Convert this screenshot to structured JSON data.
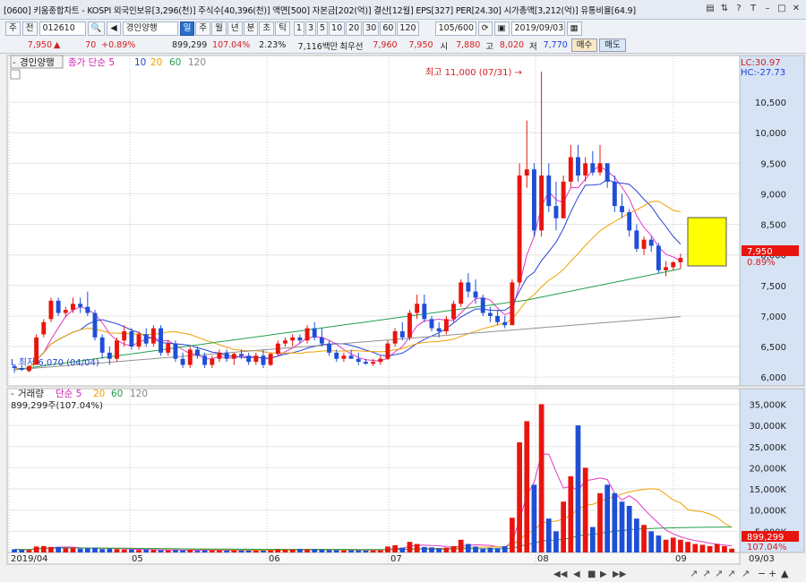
{
  "window": {
    "title": "[0600] 키움종합차트 - KOSPI 외국인보유[3,296(천)] 주식수[40,396(천)] 액면[500] 자본금[202(억)] 결산[12월] EPS[327] PER[24.30] 시가총액[3,212(억)] 유통비율[64.9]"
  },
  "toolbar": {
    "type_label": "주",
    "prev_label": "전",
    "code": "012610",
    "stock_name": "경인양행",
    "period_tabs": [
      "일",
      "주",
      "월",
      "년",
      "분",
      "초",
      "틱"
    ],
    "active_period": "일",
    "intervals": [
      "1",
      "3",
      "5",
      "10",
      "20",
      "30",
      "60",
      "120"
    ],
    "count": "105/600",
    "date": "2019/09/03"
  },
  "quote": {
    "price": "7,950",
    "change": "70",
    "change_pct": "+0.89%",
    "volume": "899,299",
    "volume_ratio": "107.04%",
    "turnover": "2.23%",
    "amount": "7,116백만",
    "best_label": "최우선",
    "ask": "7,960",
    "bid": "7,950",
    "open_label": "시",
    "open": "7,880",
    "high_label": "고",
    "high": "8,020",
    "low_label": "저",
    "low": "7,770",
    "buy_label": "매수",
    "sell_label": "매도"
  },
  "price_pane": {
    "legend_name": "경인양행",
    "legend_ma": "종가 단순 5",
    "ma_periods": [
      "10",
      "20",
      "60",
      "120"
    ],
    "lc_label": "LC:30.97",
    "hc_label": "HC:-27.73",
    "high_annotation": "최고 11,000 (07/31) →",
    "low_annotation": "L 최저 6,070 (04/04)",
    "current_price_tag": "7,950",
    "current_pct_tag": "0.89%"
  },
  "volume_pane": {
    "legend_name": "거래량",
    "legend_ma": "단순 5",
    "ma_periods": [
      "20",
      "60",
      "120"
    ],
    "info": "899,299주(107.04%)",
    "current_tag": "899,299",
    "pct_tag": "107.04%"
  },
  "colors": {
    "up": "#e8150f",
    "down": "#1f4fd6",
    "ma5": "#e038c8",
    "ma10": "#2a44d8",
    "ma20": "#f0a000",
    "ma60": "#22a04a",
    "ma120": "#909090",
    "highlight_box": "#ffff00"
  },
  "chart_data": {
    "type": "candlestick",
    "x_axis_labels": [
      "2019/04",
      "05",
      "06",
      "07",
      "08",
      "09",
      "09/03"
    ],
    "price_axis": {
      "ticks": [
        6000,
        6500,
        7000,
        7500,
        8000,
        8500,
        9000,
        9500,
        10000,
        10500
      ],
      "ylim": [
        5900,
        11000
      ]
    },
    "volume_axis": {
      "ticks_labels": [
        "5,000K",
        "10,000K",
        "15,000K",
        "20,000K",
        "25,000K",
        "30,000K",
        "35,000K"
      ],
      "ylim": [
        0,
        37000
      ]
    },
    "ohlc": [
      [
        6180,
        6200,
        6070,
        6150
      ],
      [
        6150,
        6200,
        6100,
        6120
      ],
      [
        6100,
        6200,
        6080,
        6180
      ],
      [
        6200,
        6700,
        6200,
        6650
      ],
      [
        6700,
        6950,
        6650,
        6900
      ],
      [
        6950,
        7300,
        6900,
        7250
      ],
      [
        7250,
        7300,
        7000,
        7050
      ],
      [
        7050,
        7150,
        6980,
        7100
      ],
      [
        7100,
        7300,
        7050,
        7200
      ],
      [
        7200,
        7300,
        7050,
        7150
      ],
      [
        7150,
        7400,
        7000,
        7050
      ],
      [
        7050,
        7100,
        6600,
        6650
      ],
      [
        6650,
        6700,
        6300,
        6400
      ],
      [
        6400,
        6500,
        6200,
        6300
      ],
      [
        6300,
        6650,
        6250,
        6600
      ],
      [
        6600,
        6850,
        6500,
        6750
      ],
      [
        6750,
        6800,
        6450,
        6500
      ],
      [
        6500,
        6750,
        6450,
        6700
      ],
      [
        6700,
        6800,
        6500,
        6550
      ],
      [
        6550,
        6850,
        6500,
        6800
      ],
      [
        6800,
        6850,
        6350,
        6400
      ],
      [
        6400,
        6600,
        6350,
        6550
      ],
      [
        6550,
        6600,
        6250,
        6300
      ],
      [
        6300,
        6400,
        6150,
        6200
      ],
      [
        6200,
        6500,
        6150,
        6450
      ],
      [
        6450,
        6500,
        6300,
        6350
      ],
      [
        6350,
        6400,
        6150,
        6200
      ],
      [
        6200,
        6350,
        6150,
        6300
      ],
      [
        6300,
        6450,
        6250,
        6400
      ],
      [
        6400,
        6450,
        6250,
        6300
      ],
      [
        6300,
        6400,
        6200,
        6380
      ],
      [
        6380,
        6450,
        6300,
        6350
      ],
      [
        6350,
        6400,
        6200,
        6250
      ],
      [
        6250,
        6400,
        6200,
        6350
      ],
      [
        6350,
        6450,
        6150,
        6200
      ],
      [
        6200,
        6400,
        6180,
        6380
      ],
      [
        6380,
        6600,
        6350,
        6550
      ],
      [
        6550,
        6650,
        6500,
        6600
      ],
      [
        6600,
        6700,
        6500,
        6650
      ],
      [
        6650,
        6700,
        6550,
        6600
      ],
      [
        6600,
        6850,
        6550,
        6800
      ],
      [
        6800,
        6900,
        6600,
        6650
      ],
      [
        6650,
        6800,
        6500,
        6550
      ],
      [
        6550,
        6600,
        6350,
        6400
      ],
      [
        6400,
        6450,
        6250,
        6300
      ],
      [
        6300,
        6400,
        6250,
        6350
      ],
      [
        6350,
        6450,
        6300,
        6300
      ],
      [
        6300,
        6400,
        6200,
        6250
      ],
      [
        6250,
        6300,
        6200,
        6220
      ],
      [
        6220,
        6300,
        6180,
        6250
      ],
      [
        6250,
        6350,
        6200,
        6300
      ],
      [
        6300,
        6600,
        6280,
        6550
      ],
      [
        6550,
        6800,
        6500,
        6750
      ],
      [
        6750,
        6900,
        6600,
        6650
      ],
      [
        6650,
        7100,
        6600,
        7050
      ],
      [
        7050,
        7350,
        6950,
        7200
      ],
      [
        7200,
        7350,
        6900,
        6950
      ],
      [
        6950,
        7000,
        6750,
        6800
      ],
      [
        6800,
        6900,
        6650,
        6750
      ],
      [
        6750,
        7000,
        6700,
        6950
      ],
      [
        6950,
        7250,
        6900,
        7200
      ],
      [
        7200,
        7600,
        7150,
        7550
      ],
      [
        7550,
        7700,
        7300,
        7400
      ],
      [
        7400,
        7600,
        7200,
        7300
      ],
      [
        7300,
        7350,
        7000,
        7050
      ],
      [
        7050,
        7150,
        6900,
        7000
      ],
      [
        7000,
        7100,
        6850,
        6900
      ],
      [
        6900,
        7000,
        6800,
        6850
      ],
      [
        6850,
        7600,
        6850,
        7550
      ],
      [
        7550,
        9500,
        7500,
        9300
      ],
      [
        9300,
        10200,
        9100,
        9400
      ],
      [
        9400,
        9500,
        8300,
        8400
      ],
      [
        8400,
        11000,
        8300,
        9300
      ],
      [
        9300,
        9500,
        8700,
        8800
      ],
      [
        8800,
        9200,
        8400,
        8600
      ],
      [
        8600,
        9300,
        8600,
        9200
      ],
      [
        9200,
        9800,
        9100,
        9600
      ],
      [
        9600,
        9800,
        9200,
        9300
      ],
      [
        9300,
        9600,
        9200,
        9500
      ],
      [
        9500,
        9700,
        9300,
        9350
      ],
      [
        9350,
        9800,
        9300,
        9500
      ],
      [
        9500,
        9500,
        9100,
        9200
      ],
      [
        9200,
        9300,
        8700,
        8800
      ],
      [
        8800,
        9000,
        8600,
        8700
      ],
      [
        8700,
        8750,
        8300,
        8400
      ],
      [
        8400,
        8500,
        8050,
        8100
      ],
      [
        8100,
        8300,
        8000,
        8250
      ],
      [
        8250,
        8300,
        8050,
        8150
      ],
      [
        8150,
        8200,
        7700,
        7750
      ],
      [
        7750,
        7900,
        7650,
        7800
      ],
      [
        7800,
        7900,
        7750,
        7880
      ],
      [
        7880,
        8020,
        7770,
        7950
      ]
    ],
    "volume": [
      750,
      650,
      600,
      1400,
      1500,
      1300,
      1300,
      1000,
      1100,
      900,
      1000,
      1100,
      800,
      900,
      800,
      700,
      700,
      600,
      700,
      600,
      500,
      500,
      600,
      500,
      600,
      400,
      500,
      500,
      500,
      450,
      500,
      500,
      450,
      450,
      450,
      500,
      700,
      650,
      700,
      800,
      700,
      750,
      650,
      550,
      550,
      500,
      550,
      500,
      450,
      500,
      500,
      1400,
      1700,
      1100,
      2500,
      2000,
      1300,
      1200,
      1000,
      1100,
      1500,
      3000,
      2000,
      1400,
      900,
      1100,
      1000,
      1500,
      8200,
      26000,
      31000,
      16000,
      35000,
      8000,
      5000,
      12000,
      18000,
      30000,
      20000,
      6000,
      14000,
      16000,
      14000,
      12000,
      11000,
      8000,
      6500,
      5000,
      4000,
      3000,
      3500,
      3000,
      2500,
      2000,
      1800,
      1500,
      2000,
      1500,
      900
    ],
    "ma": {
      "periods": [
        5,
        10,
        20,
        60,
        120
      ]
    }
  }
}
